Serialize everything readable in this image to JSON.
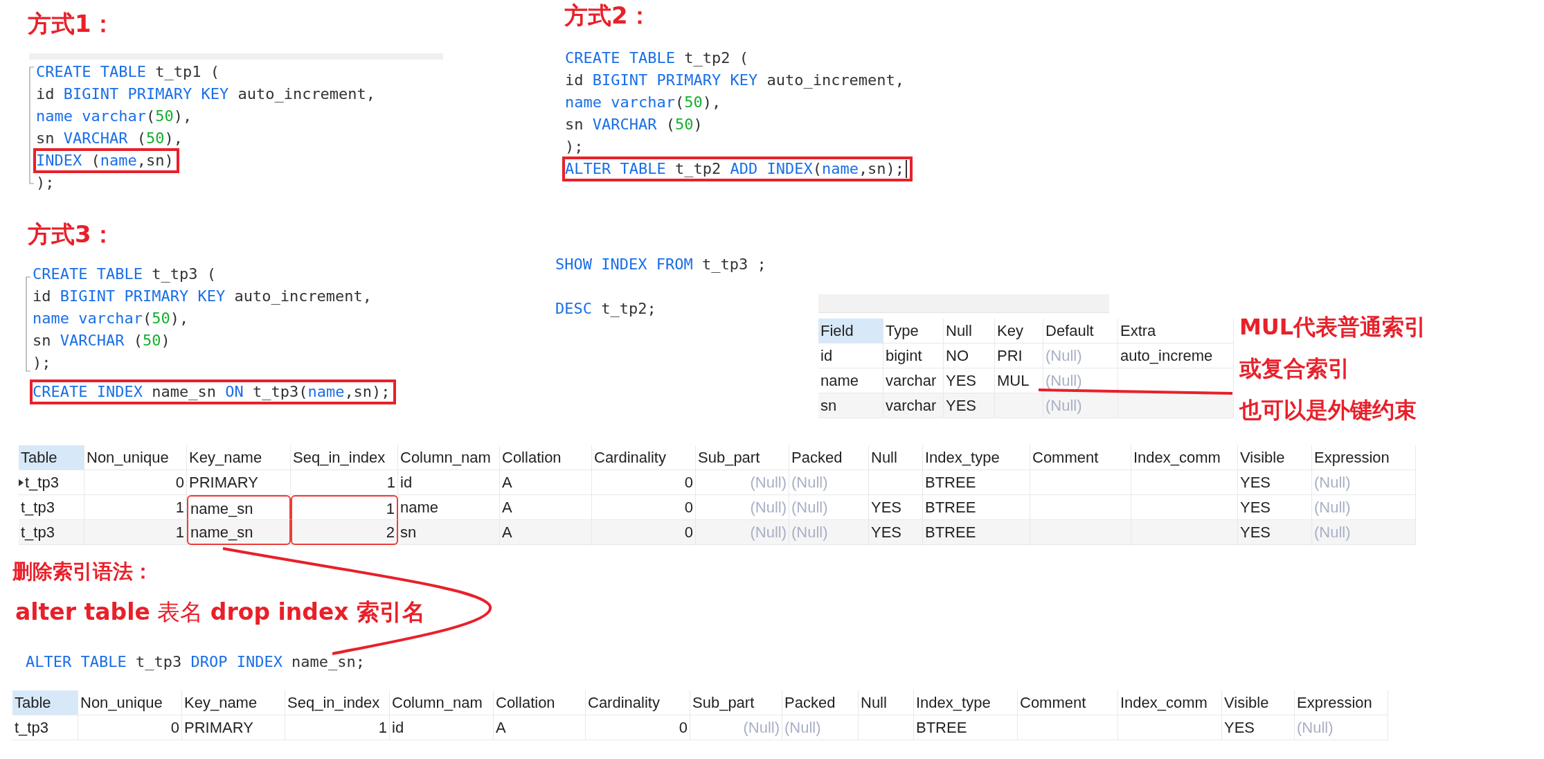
{
  "headings": [
    "方式1：",
    "方式2：",
    "方式3："
  ],
  "code_blocks": [
    {
      "fold": true,
      "lines": [
        {
          "boxed": false,
          "cursor": false,
          "segments": [
            {
              "text": "CREATE TABLE",
              "kind": "keyword"
            },
            {
              "text": " t_tp1 (",
              "kind": "plain"
            }
          ]
        },
        {
          "boxed": false,
          "cursor": false,
          "segments": [
            {
              "text": "id ",
              "kind": "plain"
            },
            {
              "text": "BIGINT PRIMARY KEY",
              "kind": "keyword"
            },
            {
              "text": " auto_increment,",
              "kind": "plain"
            }
          ]
        },
        {
          "boxed": false,
          "cursor": false,
          "segments": [
            {
              "text": "name varchar",
              "kind": "keyword"
            },
            {
              "text": "(",
              "kind": "plain"
            },
            {
              "text": "50",
              "kind": "number"
            },
            {
              "text": "),",
              "kind": "plain"
            }
          ]
        },
        {
          "boxed": false,
          "cursor": false,
          "segments": [
            {
              "text": "sn ",
              "kind": "plain"
            },
            {
              "text": "VARCHAR",
              "kind": "keyword"
            },
            {
              "text": " (",
              "kind": "plain"
            },
            {
              "text": "50",
              "kind": "number"
            },
            {
              "text": "),",
              "kind": "plain"
            }
          ]
        },
        {
          "boxed": true,
          "cursor": false,
          "segments": [
            {
              "text": "INDEX",
              "kind": "keyword"
            },
            {
              "text": " (",
              "kind": "plain"
            },
            {
              "text": "name",
              "kind": "keyword"
            },
            {
              "text": ",sn)",
              "kind": "plain"
            }
          ]
        },
        {
          "boxed": false,
          "cursor": false,
          "segments": [
            {
              "text": ");",
              "kind": "plain"
            }
          ]
        }
      ]
    },
    {
      "fold": false,
      "lines": [
        {
          "boxed": false,
          "cursor": false,
          "segments": [
            {
              "text": "CREATE TABLE",
              "kind": "keyword"
            },
            {
              "text": " t_tp2 (",
              "kind": "plain"
            }
          ]
        },
        {
          "boxed": false,
          "cursor": false,
          "segments": [
            {
              "text": "id ",
              "kind": "plain"
            },
            {
              "text": "BIGINT PRIMARY KEY",
              "kind": "keyword"
            },
            {
              "text": " auto_increment,",
              "kind": "plain"
            }
          ]
        },
        {
          "boxed": false,
          "cursor": false,
          "segments": [
            {
              "text": "name varchar",
              "kind": "keyword"
            },
            {
              "text": "(",
              "kind": "plain"
            },
            {
              "text": "50",
              "kind": "number"
            },
            {
              "text": "),",
              "kind": "plain"
            }
          ]
        },
        {
          "boxed": false,
          "cursor": false,
          "segments": [
            {
              "text": "sn ",
              "kind": "plain"
            },
            {
              "text": "VARCHAR",
              "kind": "keyword"
            },
            {
              "text": " (",
              "kind": "plain"
            },
            {
              "text": "50",
              "kind": "number"
            },
            {
              "text": ")",
              "kind": "plain"
            }
          ]
        },
        {
          "boxed": false,
          "cursor": false,
          "segments": [
            {
              "text": ");",
              "kind": "plain"
            }
          ]
        },
        {
          "boxed": true,
          "cursor": true,
          "segments": [
            {
              "text": "ALTER TABLE",
              "kind": "keyword"
            },
            {
              "text": " t_tp2 ",
              "kind": "plain"
            },
            {
              "text": "ADD INDEX",
              "kind": "keyword"
            },
            {
              "text": "(",
              "kind": "plain"
            },
            {
              "text": "name",
              "kind": "keyword"
            },
            {
              "text": ",sn);",
              "kind": "plain"
            }
          ]
        }
      ]
    },
    {
      "fold": true,
      "lines": [
        {
          "boxed": false,
          "cursor": false,
          "segments": [
            {
              "text": "CREATE TABLE",
              "kind": "keyword"
            },
            {
              "text": " t_tp3 (",
              "kind": "plain"
            }
          ]
        },
        {
          "boxed": false,
          "cursor": false,
          "segments": [
            {
              "text": "id ",
              "kind": "plain"
            },
            {
              "text": "BIGINT PRIMARY KEY",
              "kind": "keyword"
            },
            {
              "text": " auto_increment,",
              "kind": "plain"
            }
          ]
        },
        {
          "boxed": false,
          "cursor": false,
          "segments": [
            {
              "text": "name varchar",
              "kind": "keyword"
            },
            {
              "text": "(",
              "kind": "plain"
            },
            {
              "text": "50",
              "kind": "number"
            },
            {
              "text": "),",
              "kind": "plain"
            }
          ]
        },
        {
          "boxed": false,
          "cursor": false,
          "segments": [
            {
              "text": "sn ",
              "kind": "plain"
            },
            {
              "text": "VARCHAR",
              "kind": "keyword"
            },
            {
              "text": " (",
              "kind": "plain"
            },
            {
              "text": "50",
              "kind": "number"
            },
            {
              "text": ")",
              "kind": "plain"
            }
          ]
        },
        {
          "boxed": false,
          "cursor": false,
          "segments": [
            {
              "text": ");",
              "kind": "plain"
            }
          ]
        }
      ]
    },
    {
      "fold": false,
      "lines": [
        {
          "boxed": true,
          "cursor": false,
          "segments": [
            {
              "text": "CREATE INDEX",
              "kind": "keyword"
            },
            {
              "text": " name_sn ",
              "kind": "plain"
            },
            {
              "text": "ON",
              "kind": "keyword"
            },
            {
              "text": " t_tp3(",
              "kind": "plain"
            },
            {
              "text": "name",
              "kind": "keyword"
            },
            {
              "text": ",sn);",
              "kind": "plain"
            }
          ]
        }
      ]
    },
    {
      "fold": false,
      "lines": [
        {
          "boxed": false,
          "cursor": false,
          "segments": [
            {
              "text": "SHOW INDEX FROM",
              "kind": "keyword"
            },
            {
              "text": " t_tp3 ;",
              "kind": "plain"
            }
          ]
        }
      ]
    },
    {
      "fold": false,
      "lines": [
        {
          "boxed": false,
          "cursor": false,
          "segments": [
            {
              "text": "DESC",
              "kind": "keyword"
            },
            {
              "text": " t_tp2;",
              "kind": "plain"
            }
          ]
        }
      ]
    },
    {
      "fold": false,
      "lines": [
        {
          "boxed": false,
          "cursor": false,
          "segments": [
            {
              "text": "ALTER TABLE",
              "kind": "keyword"
            },
            {
              "text": " t_tp3 ",
              "kind": "plain"
            },
            {
              "text": "DROP INDEX",
              "kind": "keyword"
            },
            {
              "text": " name_sn;",
              "kind": "plain"
            }
          ]
        }
      ]
    }
  ],
  "tables": [
    {
      "columns": [
        {
          "name": "Field"
        },
        {
          "name": "Type"
        },
        {
          "name": "Null"
        },
        {
          "name": "Key"
        },
        {
          "name": "Default"
        },
        {
          "name": "Extra"
        }
      ],
      "rows": [
        {
          "current": false,
          "cells": [
            "id",
            "bigint",
            "NO",
            "PRI",
            {
              "text": "(Null)",
              "kind": "null"
            },
            "auto_increme"
          ]
        },
        {
          "current": false,
          "cells": [
            "name",
            "varchar",
            "YES",
            "MUL",
            {
              "text": "(Null)",
              "kind": "null"
            },
            null
          ]
        },
        {
          "current": false,
          "cells": [
            "sn",
            "varchar",
            "YES",
            null,
            {
              "text": "(Null)",
              "kind": "null"
            },
            null
          ]
        }
      ]
    },
    {
      "columns": [
        {
          "name": "Table"
        },
        {
          "name": "Non_unique"
        },
        {
          "name": "Key_name"
        },
        {
          "name": "Seq_in_index"
        },
        {
          "name": "Column_nam"
        },
        {
          "name": "Collation"
        },
        {
          "name": "Cardinality"
        },
        {
          "name": "Sub_part"
        },
        {
          "name": "Packed"
        },
        {
          "name": "Null"
        },
        {
          "name": "Index_type"
        },
        {
          "name": "Comment"
        },
        {
          "name": "Index_comm"
        },
        {
          "name": "Visible"
        },
        {
          "name": "Expression"
        }
      ],
      "rows": [
        {
          "current": true,
          "cells": [
            "t_tp3",
            "0",
            "PRIMARY",
            "1",
            "id",
            "A",
            "0",
            {
              "text": "(Null)",
              "kind": "null"
            },
            {
              "text": "(Null)",
              "kind": "null"
            },
            null,
            "BTREE",
            null,
            null,
            "YES",
            {
              "text": "(Null)",
              "kind": "null"
            }
          ]
        },
        {
          "current": false,
          "cells": [
            "t_tp3",
            "1",
            {
              "text": "name_sn",
              "kind": "boxed"
            },
            {
              "text": "1",
              "kind": "boxed"
            },
            "name",
            "A",
            "0",
            {
              "text": "(Null)",
              "kind": "null"
            },
            {
              "text": "(Null)",
              "kind": "null"
            },
            "YES",
            "BTREE",
            null,
            null,
            "YES",
            {
              "text": "(Null)",
              "kind": "null"
            }
          ]
        },
        {
          "current": false,
          "cells": [
            "t_tp3",
            "1",
            {
              "text": "name_sn",
              "kind": "boxed"
            },
            {
              "text": "2",
              "kind": "boxed"
            },
            "sn",
            "A",
            "0",
            {
              "text": "(Null)",
              "kind": "null"
            },
            {
              "text": "(Null)",
              "kind": "null"
            },
            "YES",
            "BTREE",
            null,
            null,
            "YES",
            {
              "text": "(Null)",
              "kind": "null"
            }
          ]
        }
      ]
    },
    {
      "columns": [
        {
          "name": "Table"
        },
        {
          "name": "Non_unique"
        },
        {
          "name": "Key_name"
        },
        {
          "name": "Seq_in_index"
        },
        {
          "name": "Column_nam"
        },
        {
          "name": "Collation"
        },
        {
          "name": "Cardinality"
        },
        {
          "name": "Sub_part"
        },
        {
          "name": "Packed"
        },
        {
          "name": "Null"
        },
        {
          "name": "Index_type"
        },
        {
          "name": "Comment"
        },
        {
          "name": "Index_comm"
        },
        {
          "name": "Visible"
        },
        {
          "name": "Expression"
        }
      ],
      "rows": [
        {
          "current": false,
          "cells": [
            "t_tp3",
            "0",
            "PRIMARY",
            "1",
            "id",
            "A",
            "0",
            {
              "text": "(Null)",
              "kind": "null"
            },
            {
              "text": "(Null)",
              "kind": "null"
            },
            null,
            "BTREE",
            null,
            null,
            "YES",
            {
              "text": "(Null)",
              "kind": "null"
            }
          ]
        }
      ]
    }
  ],
  "notes": [
    "MUL代表普通索引",
    "或复合索引",
    "也可以是外键约束"
  ],
  "delete_section": {
    "heading": "删除索引语法：",
    "syntax": "**alter table** 表名 **drop index 索引名**"
  }
}
